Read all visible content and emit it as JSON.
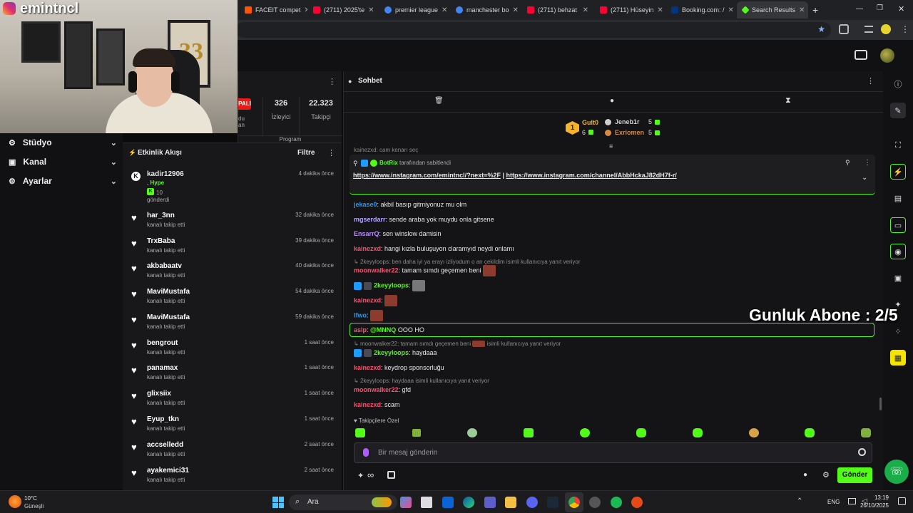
{
  "browser": {
    "tabs": [
      {
        "label": "FACEIT compet",
        "color": "#ff5500"
      },
      {
        "label": "(2711) 2025'te",
        "color": "#ff0033"
      },
      {
        "label": "premier league",
        "color": "#4285f4"
      },
      {
        "label": "manchester bo",
        "color": "#4285f4"
      },
      {
        "label": "(2711) behzat",
        "color": "#ff0033"
      },
      {
        "label": "(2711) Hüseyin",
        "color": "#ff0033"
      },
      {
        "label": "Booking.com: /",
        "color": "#003580"
      },
      {
        "label": "Search Results",
        "color": "#53fc18"
      }
    ],
    "new_tab": "+",
    "minimize": "—",
    "restore": "❐",
    "close": "✕"
  },
  "overlay": {
    "streamer_name": "emintncl",
    "sub_goal": "Gunluk Abone : 2/5"
  },
  "sidebar": {
    "items": [
      {
        "label": "Stüdyo",
        "icon": "studio-icon"
      },
      {
        "label": "Kanal",
        "icon": "channel-icon"
      },
      {
        "label": "Ayarlar",
        "icon": "settings-icon"
      }
    ]
  },
  "stream_info": {
    "live_badge": "PALI",
    "viewers_count": "326",
    "viewers_label": "İzleyici",
    "followers_count": "22.323",
    "followers_label": "Takipçi",
    "program_label": "Program",
    "partial_text": "du\nan"
  },
  "activity": {
    "title": "Etkinlik Akışı",
    "filter_label": "Filtre",
    "hype_event": {
      "user": "kadir12906",
      "prefix": ", ",
      "hype": "Hype",
      "amount": "10",
      "action": "gönderdi",
      "time": "4 dakika önce"
    },
    "follows": [
      {
        "user": "har_3nn",
        "action": "kanalı takip etti",
        "time": "32 dakika önce"
      },
      {
        "user": "TrxBaba",
        "action": "kanalı takip etti",
        "time": "39 dakika önce"
      },
      {
        "user": "akbabaatv",
        "action": "kanalı takip etti",
        "time": "40 dakika önce"
      },
      {
        "user": "MaviMustafa",
        "action": "kanalı takip etti",
        "time": "54 dakika önce"
      },
      {
        "user": "MaviMustafa",
        "action": "kanalı takip etti",
        "time": "59 dakika önce"
      },
      {
        "user": "bengrout",
        "action": "kanalı takip etti",
        "time": "1 saat önce"
      },
      {
        "user": "panamax",
        "action": "kanalı takip etti",
        "time": "1 saat önce"
      },
      {
        "user": "glixsiix",
        "action": "kanalı takip etti",
        "time": "1 saat önce"
      },
      {
        "user": "Eyup_tkn",
        "action": "kanalı takip etti",
        "time": "1 saat önce"
      },
      {
        "user": "accselledd",
        "action": "kanalı takip etti",
        "time": "2 saat önce"
      },
      {
        "user": "ayakemici31",
        "action": "kanalı takip etti",
        "time": "2 saat önce"
      }
    ]
  },
  "chat": {
    "title": "Sohbet",
    "leaderboard": {
      "first_name": "Gult0",
      "first_score": "6",
      "second_name": "Jeneb1r",
      "second_score": "5",
      "third_name": "Exriomen",
      "third_score": "5",
      "rank_badge": "1"
    },
    "truncated_top": "kainezxd: cam kenarı seç",
    "pinned": {
      "user": "BotRix",
      "note": "tarafından sabitlendi",
      "link1": "https://www.instagram.com/emintncl/?next=%2F",
      "separator": "|",
      "link2": "https://www.instagram.com/channel/AbbHckaJ82dH7f-r/"
    },
    "messages": [
      {
        "user": "jekase0",
        "color": "#1e9bff",
        "text": ": akbil basıp gitmiyonuz mu olm"
      },
      {
        "user": "mgserdarr",
        "color": "#b7a6ff",
        "text": ": sende araba yok muydu onla gitsene"
      },
      {
        "user": "EnsarrQ",
        "color": "#b98cff",
        "text": ": sen winslow damisin"
      },
      {
        "user": "kainezxd",
        "color": "#ff4f6e",
        "text": ": hangi kızla buluşuyon claramyıd neydi onlamı"
      }
    ],
    "reply1": "2keyyloops: ben daha iyi ya erayı izliyodum o an çekildim isimli kullanıcıya yanıt veriyor",
    "msg_moon1": {
      "user": "moonwalker22",
      "text": ": tamam sımdı geçemen beni"
    },
    "msg_2key1": {
      "user": "2keyyloops",
      "text": ":"
    },
    "msg_kain_emote": {
      "user": "kainezxd",
      "text": ":"
    },
    "msg_lfwo": {
      "user": "lfwo",
      "text": ":"
    },
    "highlight": {
      "user": "aslp",
      "mention": "@MNNQ",
      "text": "OOO HO"
    },
    "reply2_a": "moonwalker22: tamam sımdı geçemen beni",
    "reply2_b": "isimli kullanıcıya yanıt veriyor",
    "msg_2key2": {
      "user": "2keyyloops",
      "text": ": haydaaa"
    },
    "msg_kain2": {
      "user": "kainezxd",
      "text": ": keydrop sponsorluğu"
    },
    "reply3": "2keyyloops: haydaaa isimli kullanıcıya yanıt veriyor",
    "msg_moon2": {
      "user": "moonwalker22",
      "text": ": gfd"
    },
    "msg_kain3": {
      "user": "kainezxd",
      "text": ": scam"
    },
    "followers_only": "Takipçilere Özel",
    "input_placeholder": "Bir mesaj gönderin",
    "send_label": "Gönder",
    "infinity": "∞"
  },
  "taskbar": {
    "weather_temp": "10°C",
    "weather_desc": "Güneşli",
    "search_label": "Ara",
    "lang": "ENG",
    "time": "13:19",
    "date": "26/10/2025"
  },
  "colors": {
    "kick_green": "#53fc18",
    "highlight_border": "#53fc18",
    "name_red": "#ff4f6e"
  }
}
